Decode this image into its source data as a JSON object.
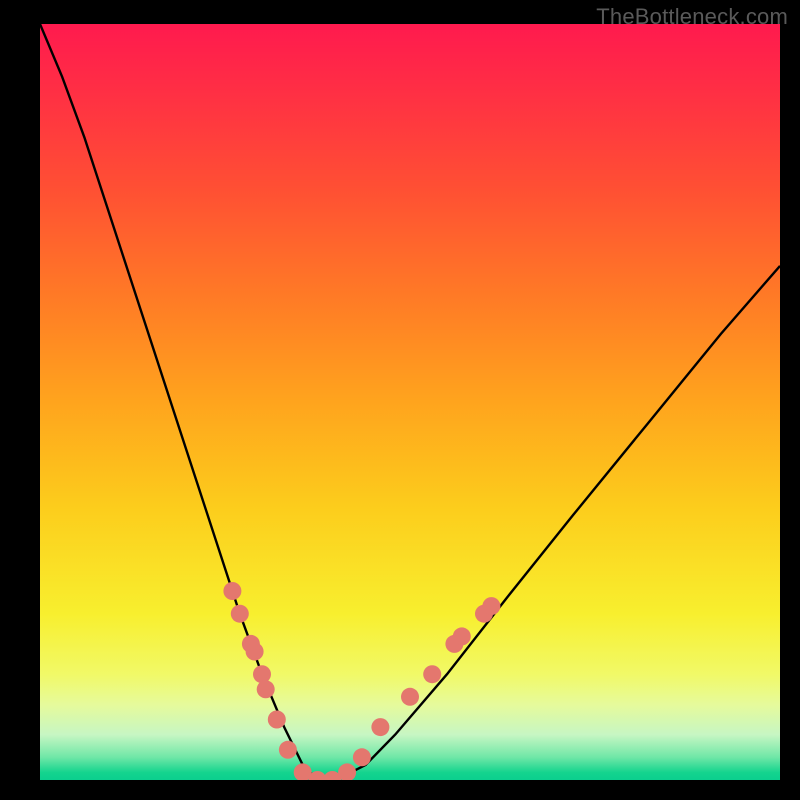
{
  "watermark": "TheBottleneck.com",
  "chart_data": {
    "type": "line",
    "title": "",
    "xlabel": "",
    "ylabel": "",
    "xlim": [
      0,
      1
    ],
    "ylim": [
      0,
      100
    ],
    "notes": "V-shaped bottleneck curve. Background gradient encodes bottleneck percentage: top (red) = 100%, bottom (green) = 0%. Vertex at roughly x≈0.37.",
    "series": [
      {
        "name": "bottleneck-curve",
        "x": [
          0.0,
          0.03,
          0.06,
          0.09,
          0.12,
          0.15,
          0.18,
          0.21,
          0.24,
          0.27,
          0.3,
          0.33,
          0.36,
          0.4,
          0.44,
          0.48,
          0.55,
          0.63,
          0.72,
          0.82,
          0.92,
          1.0
        ],
        "y": [
          100,
          93,
          85,
          76,
          67,
          58,
          49,
          40,
          31,
          22,
          14,
          7,
          1,
          0,
          2,
          6,
          14,
          24,
          35,
          47,
          59,
          68
        ]
      }
    ],
    "markers": {
      "comment": "Salmon-pink dots clustered along the lower portion of both arms of the V, interpreted as sampled hardware configurations near the balance point.",
      "points": [
        {
          "x": 0.26,
          "y": 25
        },
        {
          "x": 0.27,
          "y": 22
        },
        {
          "x": 0.285,
          "y": 18
        },
        {
          "x": 0.29,
          "y": 17
        },
        {
          "x": 0.3,
          "y": 14
        },
        {
          "x": 0.305,
          "y": 12
        },
        {
          "x": 0.32,
          "y": 8
        },
        {
          "x": 0.335,
          "y": 4
        },
        {
          "x": 0.355,
          "y": 1
        },
        {
          "x": 0.375,
          "y": 0
        },
        {
          "x": 0.395,
          "y": 0
        },
        {
          "x": 0.415,
          "y": 1
        },
        {
          "x": 0.435,
          "y": 3
        },
        {
          "x": 0.46,
          "y": 7
        },
        {
          "x": 0.5,
          "y": 11
        },
        {
          "x": 0.53,
          "y": 14
        },
        {
          "x": 0.56,
          "y": 18
        },
        {
          "x": 0.57,
          "y": 19
        },
        {
          "x": 0.6,
          "y": 22
        },
        {
          "x": 0.61,
          "y": 23
        }
      ],
      "color": "#e4776e",
      "radius": 9
    }
  }
}
